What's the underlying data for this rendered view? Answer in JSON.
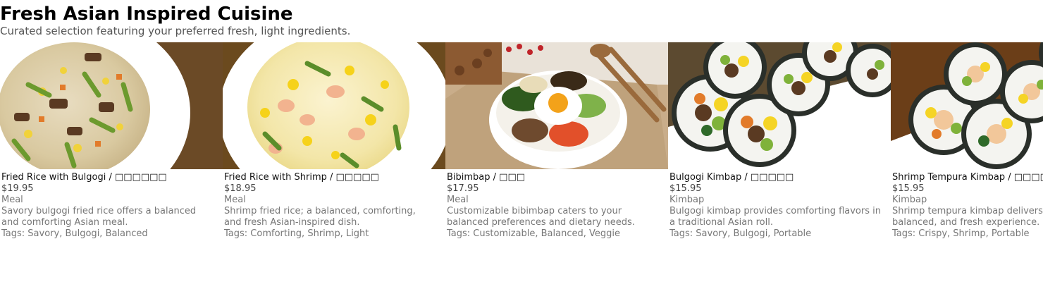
{
  "page": {
    "title": "Fresh Asian Inspired Cuisine",
    "subtitle": "Curated selection featuring your preferred fresh, light ingredients."
  },
  "items": [
    {
      "name": "Fried Rice with Bulgogi / □□□□□□",
      "price": "$19.95",
      "category": "Meal",
      "description": "Savory bulgogi fried rice offers a balanced and comforting Asian meal.",
      "tags": "Tags: Savory, Bulgogi, Balanced",
      "image_icon": "fried-rice-bulgogi-photo"
    },
    {
      "name": "Fried Rice with Shrimp / □□□□□",
      "price": "$18.95",
      "category": "Meal",
      "description": "Shrimp fried rice; a balanced, comforting, and fresh Asian-inspired dish.",
      "tags": "Tags: Comforting, Shrimp, Light",
      "image_icon": "fried-rice-shrimp-photo"
    },
    {
      "name": "Bibimbap / □□□",
      "price": "$17.95",
      "category": "Meal",
      "description": "Customizable bibimbap caters to your balanced preferences and dietary needs.",
      "tags": "Tags: Customizable, Balanced, Veggie",
      "image_icon": "bibimbap-photo"
    },
    {
      "name": "Bulgogi Kimbap / □□□□□",
      "price": "$15.95",
      "category": "Kimbap",
      "description": "Bulgogi kimbap provides comforting flavors in a traditional Asian roll.",
      "tags": "Tags: Savory, Bulgogi, Portable",
      "image_icon": "bulgogi-kimbap-photo"
    },
    {
      "name": "Shrimp Tempura Kimbap / □□□□□□",
      "price": "$15.95",
      "category": "Kimbap",
      "description": "Shrimp tempura kimbap delivers a satisfying, balanced, and fresh experience.",
      "tags": "Tags: Crispy, Shrimp, Portable",
      "image_icon": "shrimp-tempura-kimbap-photo"
    }
  ]
}
